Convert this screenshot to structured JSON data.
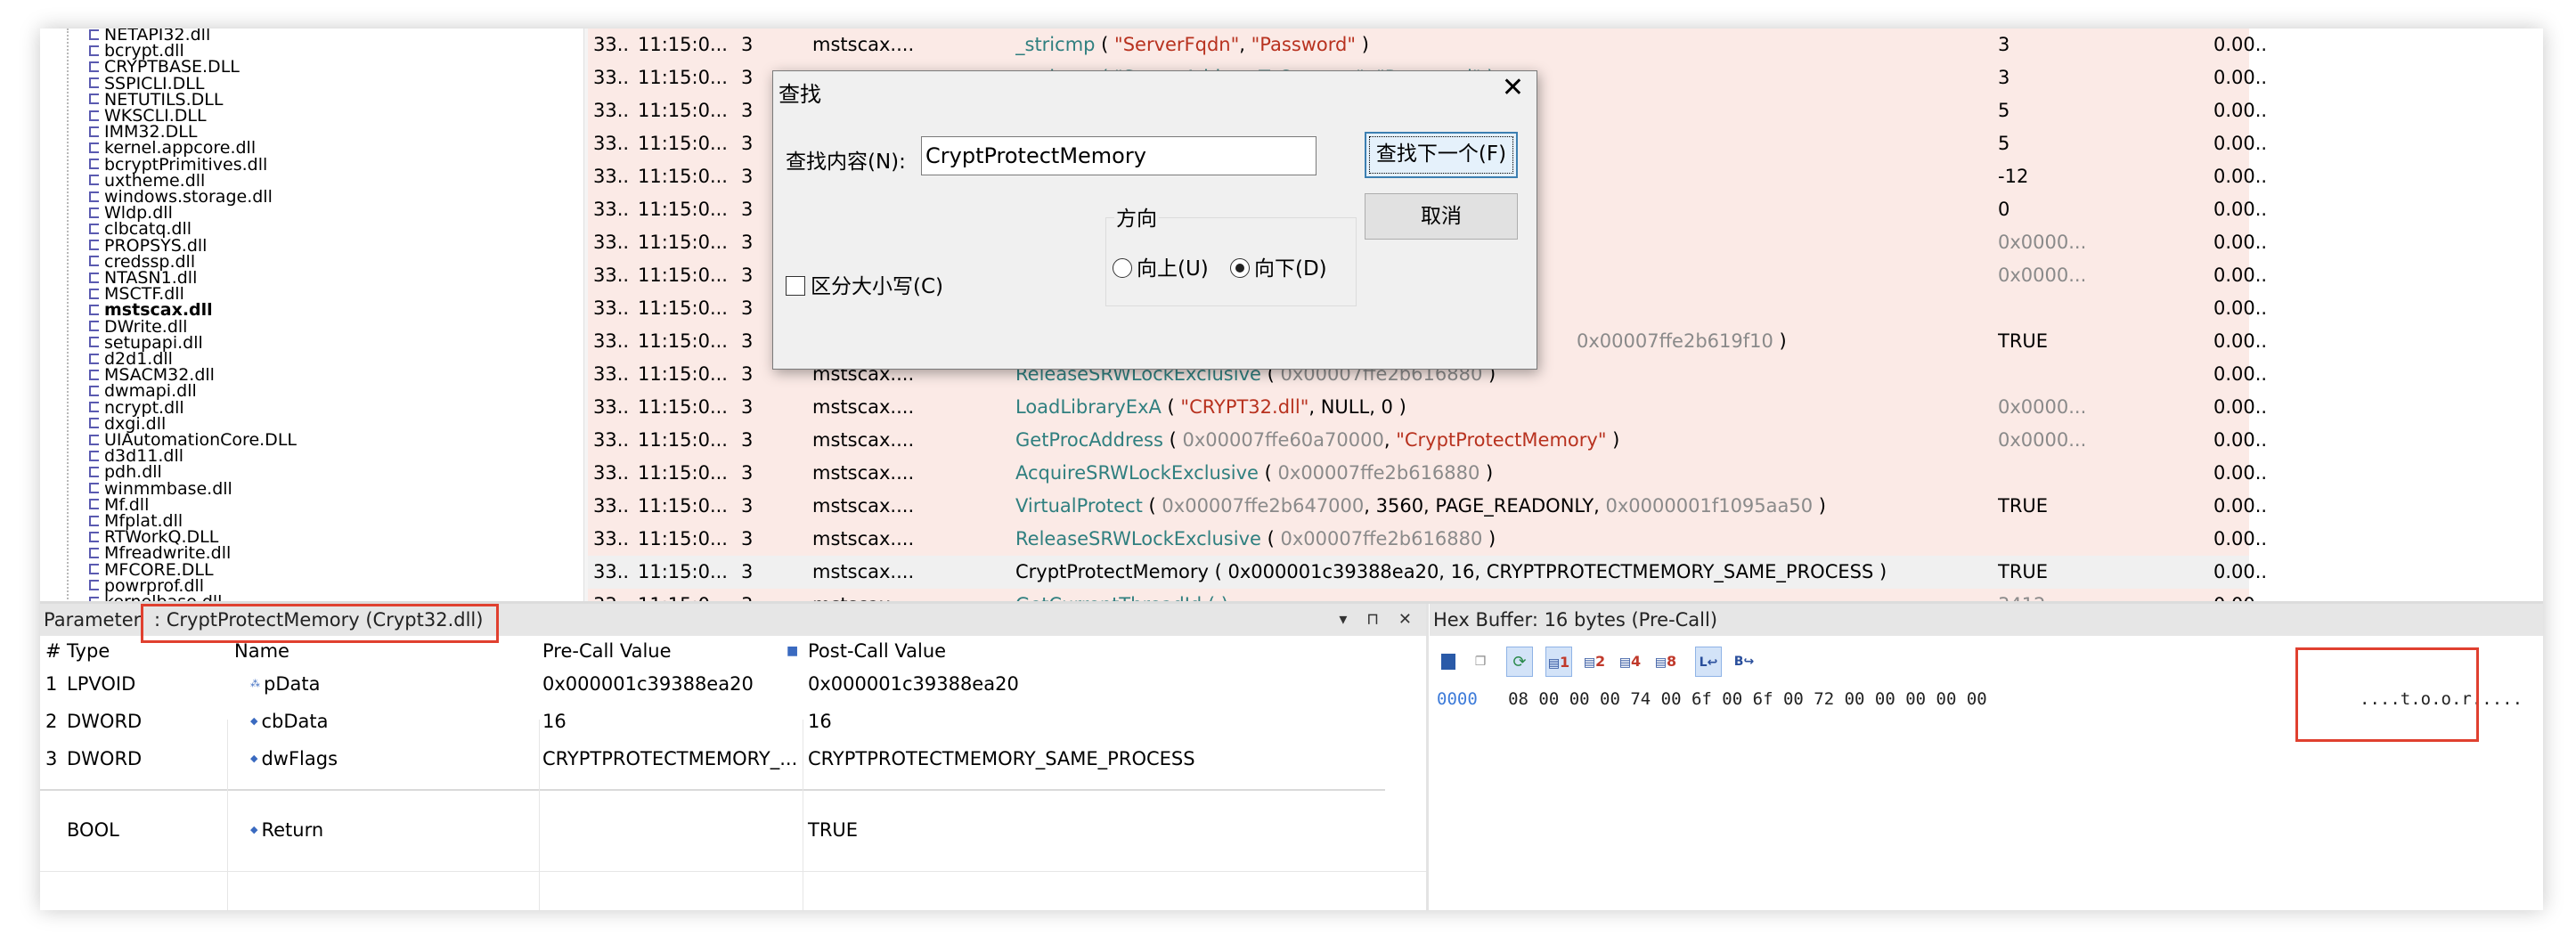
{
  "tree": {
    "items": [
      "NETAPI32.dll",
      "bcrypt.dll",
      "CRYPTBASE.DLL",
      "SSPICLI.DLL",
      "NETUTILS.DLL",
      "WKSCLI.DLL",
      "IMM32.DLL",
      "kernel.appcore.dll",
      "bcryptPrimitives.dll",
      "uxtheme.dll",
      "windows.storage.dll",
      "Wldp.dll",
      "clbcatq.dll",
      "PROPSYS.dll",
      "credssp.dll",
      "NTASN1.dll",
      "MSCTF.dll",
      "mstscax.dll",
      "DWrite.dll",
      "setupapi.dll",
      "d2d1.dll",
      "MSACM32.dll",
      "dwmapi.dll",
      "ncrypt.dll",
      "dxgi.dll",
      "UIAutomationCore.DLL",
      "d3d11.dll",
      "pdh.dll",
      "winmmbase.dll",
      "Mf.dll",
      "Mfplat.dll",
      "RTWorkQ.DLL",
      "Mfreadwrite.dll",
      "MFCORE.DLL",
      "powrprof.dll",
      "kernelbase.dll"
    ],
    "bold_item": "mstscax.dll"
  },
  "calls": [
    {
      "idx": "33...",
      "time": "11:15:0...",
      "tid": "3",
      "module": "mstscax....",
      "parts": [
        [
          "fn",
          "_stricmp"
        ],
        [
          "plain",
          " ( "
        ],
        [
          "str",
          "\"ServerFqdn\""
        ],
        [
          "plain",
          ", "
        ],
        [
          "str",
          "\"Password\""
        ],
        [
          "plain",
          " )"
        ]
      ],
      "ret": "3",
      "ret_gray": false,
      "dur": "0.00..."
    },
    {
      "idx": "33...",
      "time": "11:15:0...",
      "tid": "3",
      "module": "",
      "parts": [
        [
          "fn",
          "_stricmp ( \"ServerAddressToConnect\", \"Password\" )"
        ]
      ],
      "ret": "3",
      "ret_gray": false,
      "dur": "0.00..."
    },
    {
      "idx": "33...",
      "time": "11:15:0...",
      "tid": "3",
      "module": "",
      "parts": [],
      "ret": "5",
      "ret_gray": false,
      "dur": "0.00..."
    },
    {
      "idx": "33...",
      "time": "11:15:0...",
      "tid": "3",
      "module": "",
      "parts": [],
      "ret": "5",
      "ret_gray": false,
      "dur": "0.00..."
    },
    {
      "idx": "33...",
      "time": "11:15:0...",
      "tid": "3",
      "module": "",
      "parts": [],
      "ret": "-12",
      "ret_gray": false,
      "dur": "0.00..."
    },
    {
      "idx": "33...",
      "time": "11:15:0...",
      "tid": "3",
      "module": "",
      "parts": [],
      "ret": "0",
      "ret_gray": false,
      "dur": "0.00..."
    },
    {
      "idx": "33...",
      "time": "11:15:0...",
      "tid": "3",
      "module": "",
      "parts": [],
      "ret": "0x0000...",
      "ret_gray": true,
      "dur": "0.00..."
    },
    {
      "idx": "33...",
      "time": "11:15:0...",
      "tid": "3",
      "module": "",
      "parts": [],
      "ret": "0x0000...",
      "ret_gray": true,
      "dur": "0.00..."
    },
    {
      "idx": "33...",
      "time": "11:15:0...",
      "tid": "3",
      "module": "",
      "parts": [],
      "ret": "",
      "ret_gray": false,
      "dur": "0.00..."
    },
    {
      "idx": "33...",
      "time": "11:15:0...",
      "tid": "3",
      "module": "",
      "parts": [
        [
          "num",
          "0x00007ffe2b619f10"
        ],
        [
          "plain",
          " )"
        ]
      ],
      "ret": "TRUE",
      "ret_gray": false,
      "dur": "0.00...",
      "offset_call": true
    },
    {
      "idx": "33...",
      "time": "11:15:0...",
      "tid": "3",
      "module": "mstscax....",
      "parts": [
        [
          "fn",
          "ReleaseSRWLockExclusive"
        ],
        [
          "plain",
          " ( "
        ],
        [
          "num",
          "0x00007ffe2b616880"
        ],
        [
          "plain",
          " )"
        ]
      ],
      "ret": "",
      "ret_gray": false,
      "dur": "0.00..."
    },
    {
      "idx": "33...",
      "time": "11:15:0...",
      "tid": "3",
      "module": "mstscax....",
      "parts": [
        [
          "fn",
          "LoadLibraryExA"
        ],
        [
          "plain",
          " ( "
        ],
        [
          "str",
          "\"CRYPT32.dll\""
        ],
        [
          "plain",
          ", NULL, 0 )"
        ]
      ],
      "ret": "0x0000...",
      "ret_gray": true,
      "dur": "0.00..."
    },
    {
      "idx": "33...",
      "time": "11:15:0...",
      "tid": "3",
      "module": "mstscax....",
      "parts": [
        [
          "fn",
          "GetProcAddress"
        ],
        [
          "plain",
          " ( "
        ],
        [
          "num",
          "0x00007ffe60a70000"
        ],
        [
          "plain",
          ", "
        ],
        [
          "str",
          "\"CryptProtectMemory\""
        ],
        [
          "plain",
          " )"
        ]
      ],
      "ret": "0x0000...",
      "ret_gray": true,
      "dur": "0.00..."
    },
    {
      "idx": "33...",
      "time": "11:15:0...",
      "tid": "3",
      "module": "mstscax....",
      "parts": [
        [
          "fn",
          "AcquireSRWLockExclusive"
        ],
        [
          "plain",
          " ( "
        ],
        [
          "num",
          "0x00007ffe2b616880"
        ],
        [
          "plain",
          " )"
        ]
      ],
      "ret": "",
      "ret_gray": false,
      "dur": "0.00..."
    },
    {
      "idx": "33...",
      "time": "11:15:0...",
      "tid": "3",
      "module": "mstscax....",
      "parts": [
        [
          "fn",
          "VirtualProtect"
        ],
        [
          "plain",
          " ( "
        ],
        [
          "num",
          "0x00007ffe2b647000"
        ],
        [
          "plain",
          ", 3560, PAGE_READONLY, "
        ],
        [
          "num",
          "0x0000001f1095aa50"
        ],
        [
          "plain",
          " )"
        ]
      ],
      "ret": "TRUE",
      "ret_gray": false,
      "dur": "0.00..."
    },
    {
      "idx": "33...",
      "time": "11:15:0...",
      "tid": "3",
      "module": "mstscax....",
      "parts": [
        [
          "fn",
          "ReleaseSRWLockExclusive"
        ],
        [
          "plain",
          " ( "
        ],
        [
          "num",
          "0x00007ffe2b616880"
        ],
        [
          "plain",
          " )"
        ]
      ],
      "ret": "",
      "ret_gray": false,
      "dur": "0.00..."
    },
    {
      "idx": "33...",
      "time": "11:15:0...",
      "tid": "3",
      "module": "mstscax....",
      "parts": [
        [
          "plain",
          "CryptProtectMemory ( 0x000001c39388ea20, 16, CRYPTPROTECTMEMORY_SAME_PROCESS )"
        ]
      ],
      "ret": "TRUE",
      "ret_gray": false,
      "dur": "0.00...",
      "selected": true
    },
    {
      "idx": "33...",
      "time": "11:15:0...",
      "tid": "3",
      "module": "mstscax....",
      "parts": [
        [
          "fn",
          "GetCurrentThreadId ( )"
        ]
      ],
      "ret": "3412",
      "ret_gray": true,
      "dur": "0.00..."
    }
  ],
  "find_dialog": {
    "title": "查找",
    "close": "✕",
    "find_label": "查找内容(N):",
    "find_value": "CryptProtectMemory",
    "find_next": "查找下一个(F)",
    "cancel": "取消",
    "direction_label": "方向",
    "up_label": "向上(U)",
    "down_label": "向下(D)",
    "selected_direction": "down",
    "match_case_label": "区分大小写(C)",
    "match_case": false
  },
  "params_panel": {
    "title_prefix": "Parameter",
    "title_func": ": CryptProtectMemory (Crypt32.dll)",
    "controls": "▾ ⊓ ✕",
    "headers": {
      "num": "#",
      "type": "Type",
      "name": "Name",
      "pre": "Pre-Call Value",
      "post": "Post-Call Value"
    },
    "rows": [
      {
        "num": "1",
        "type": "LPVOID",
        "name": "pData",
        "pre": "0x000001c39388ea20",
        "post": "0x000001c39388ea20"
      },
      {
        "num": "2",
        "type": "DWORD",
        "name": "cbData",
        "pre": "16",
        "post": "16"
      },
      {
        "num": "3",
        "type": "DWORD",
        "name": "dwFlags",
        "pre": "CRYPTPROTECTMEMORY_...",
        "post": "CRYPTPROTECTMEMORY_SAME_PROCESS"
      }
    ],
    "return": {
      "type": "BOOL",
      "name": "Return",
      "pre": "",
      "post": "TRUE"
    }
  },
  "hex_panel": {
    "title": "Hex Buffer: 16 bytes (Pre-Call)",
    "toolbar": {
      "b1": "1",
      "b2": "2",
      "b4": "4",
      "b8": "8",
      "l": "L",
      "b": "B"
    },
    "offset": "0000",
    "bytes": "08 00 00 00 74 00 6f 00 6f 00 72 00 00 00 00 00",
    "ascii": "....t.o.o.r....."
  },
  "colors": {
    "row_bg": "#fbeae6",
    "selected_row_bg": "#f0f0f0",
    "function_name": "#2f7f7f",
    "string_literal": "#b8321f",
    "annotation_red": "#e0402f",
    "button_focus_border": "#3c7fb1"
  }
}
